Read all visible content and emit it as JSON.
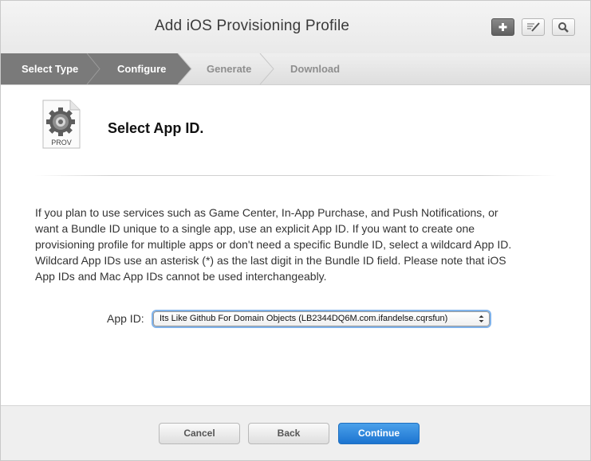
{
  "header": {
    "title": "Add iOS Provisioning Profile",
    "buttons": [
      {
        "name": "add",
        "icon": "plus-icon"
      },
      {
        "name": "edit",
        "icon": "edit-icon"
      },
      {
        "name": "search",
        "icon": "search-icon"
      }
    ]
  },
  "steps": {
    "items": [
      {
        "label": "Select Type",
        "state": "done"
      },
      {
        "label": "Configure",
        "state": "current"
      },
      {
        "label": "Generate",
        "state": "upcoming"
      },
      {
        "label": "Download",
        "state": "upcoming"
      }
    ]
  },
  "content": {
    "icon_label": "PROV",
    "section_title": "Select App ID.",
    "description": "If you plan to use services such as Game Center, In-App Purchase, and Push Notifications, or want a Bundle ID unique to a single app, use an explicit App ID. If you want to create one provisioning profile for multiple apps or don't need a specific Bundle ID, select a wildcard App ID. Wildcard App IDs use an asterisk (*) as the last digit in the Bundle ID field. Please note that iOS App IDs and Mac App IDs cannot be used interchangeably.",
    "app_id_label": "App ID:",
    "app_id_selected": "Its Like Github For Domain Objects (LB2344DQ6M.com.ifandelse.cqrsfun)"
  },
  "footer": {
    "cancel_label": "Cancel",
    "back_label": "Back",
    "continue_label": "Continue"
  },
  "colors": {
    "primary_button": "#1c74d0",
    "active_step": "#7a7a7a"
  }
}
